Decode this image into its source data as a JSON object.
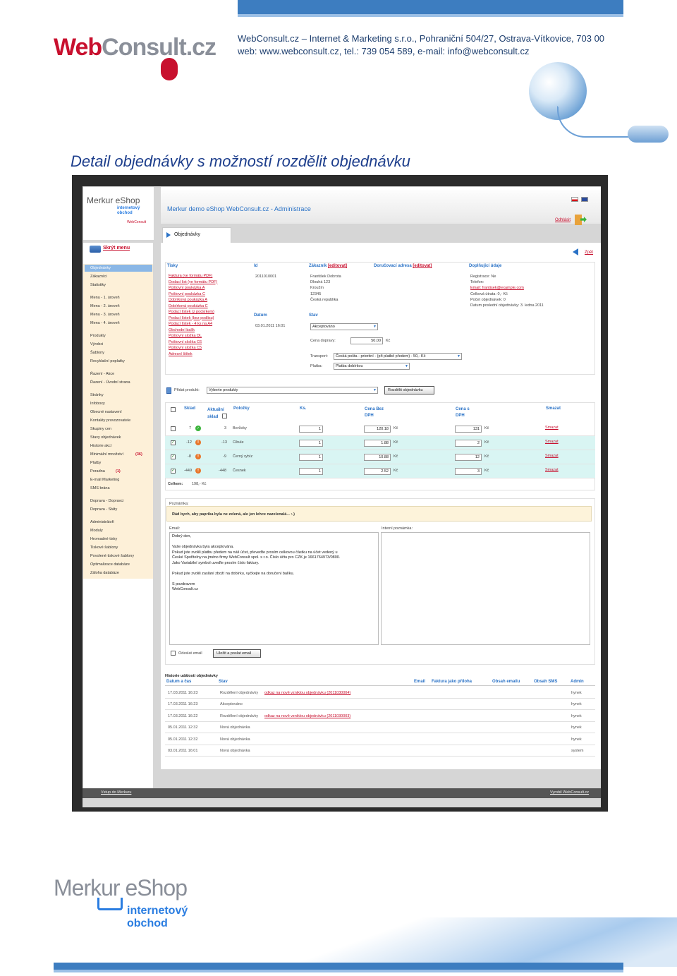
{
  "page": {
    "company_line1": "WebConsult.cz – Internet & Marketing s.r.o., Pohraniční 504/27, Ostrava-Vítkovice, 703 00",
    "company_line2": "web: www.webconsult.cz, tel.: 739 054 589, e-mail: info@webconsult.cz",
    "heading": "Detail objednávky s možností rozdělit objednávku",
    "logo_web": "Web",
    "logo_consult": "Consult.cz",
    "bottom_logo": "Merkur eShop",
    "bottom_logo_sub": "internetový obchod"
  },
  "app": {
    "sidebar_logo": "Merkur eShop",
    "sidebar_logo_sub": "internetový obchod",
    "sidebar_logo_small": "WebConsult",
    "admin_title": "Merkur demo eShop WebConsult.cz - Administrace",
    "logout": "Odhlásit",
    "tab": "Objednávky",
    "hide_menu": "Skrýt menu",
    "back": "Zpět",
    "menu": [
      "Objednávky",
      "Zákazníci",
      "Statistiky",
      "Menu - 1. úroveň",
      "Menu - 2. úroveň",
      "Menu - 3. úroveň",
      "Menu - 4. úroveň",
      "Produkty",
      "Výrobci",
      "Šablony",
      "Recyklační poplatky",
      "Řazení - Akce",
      "Řazení - Úvodní strana",
      "Stránky",
      "Infoboxy",
      "Obecné nastavení",
      "Kontakty provozovatele",
      "Skupiny cen",
      "Stavy objednávek",
      "Historie akcí",
      "Minimální množství",
      "Platby",
      "Poradna",
      "E-mail Marketing",
      "SMS brána",
      "Doprava - Dopravci",
      "Doprava - Státy",
      "Administrátoři",
      "Moduly",
      "Hromadné tisky",
      "Tiskové šablony",
      "Povolené tiskové šablony",
      "Optimalizace databáze",
      "Záloha databáze"
    ],
    "menu_badge_min": "(36)",
    "menu_badge_poradna": "(1)"
  },
  "order": {
    "headers": {
      "tisky": "Tisky",
      "id": "Id",
      "zakaznik": "Zákazník",
      "dorucovaci": "Doručovací adresa",
      "doplnujici": "Doplňující údaje",
      "editovat": "[editovat]",
      "datum": "Datum",
      "stav": "Stav"
    },
    "prints": [
      "Faktura (ve formátu PDF)",
      "Dodací list (ve formátu PDF)",
      "Poštovní poukázka A",
      "Poštovní poukázka C",
      "Dobírková poukázka A",
      "Dobírková poukázka C",
      "Podací lístek (z podsíkem)",
      "Podací lístek (bez podlisu)",
      "Podací lístek - 4 ks na A4",
      "Obchodní balík",
      "Poštovní složka DL",
      "Poštovní složka C6",
      "Poštovní složka C5",
      "Adresní štítek"
    ],
    "id": "2011010001",
    "customer": [
      "František Dobrota",
      "Dlouhá 123",
      "Kroužín",
      "12345",
      "Česká republika"
    ],
    "extra": [
      "Registrace: Ne",
      "Telefon:",
      "Email: frantisek@example.com",
      "Celková útrata: 0,- Kč",
      "Počet objednávek: 0",
      "Datum poslední objednávky: 3. ledna 2011"
    ],
    "date": "03.01.2011 16:01",
    "status": "Akceptováno",
    "shipping_price_label": "Cena dopravy:",
    "shipping_price": "50.00",
    "currency": "Kč",
    "transport_label": "Transport:",
    "transport": "Česká pošta - prioritní - (při platbě předem) - 50,- Kč",
    "payment_label": "Platba:",
    "payment": "Platba dobírkou"
  },
  "products": {
    "add_label": "Přidat produkt:",
    "add_placeholder": "Vyberte produkty",
    "split_button": "Rozdělit objednávku",
    "columns": [
      "Sklad",
      "Aktuální sklad",
      "Položky",
      "Ks.",
      "Cena Bez DPH",
      "Cena s DPH",
      "Smazat"
    ],
    "rows": [
      {
        "sklad": "7",
        "aktualni": "3",
        "name": "Borůvky",
        "ks": "1",
        "bez": "120.18",
        "s": "131",
        "ok": true,
        "checked": false
      },
      {
        "sklad": "-12",
        "aktualni": "-13",
        "name": "Cibule",
        "ks": "1",
        "bez": "1.88",
        "s": "2",
        "ok": false,
        "checked": true
      },
      {
        "sklad": "-8",
        "aktualni": "-9",
        "name": "Černý rybíz",
        "ks": "1",
        "bez": "10.88",
        "s": "12",
        "ok": false,
        "checked": true
      },
      {
        "sklad": "-449",
        "aktualni": "-448",
        "name": "Česnek",
        "ks": "1",
        "bez": "2.52",
        "s": "3",
        "ok": false,
        "checked": true
      }
    ],
    "delete": "Smazat",
    "total_label": "Celkem:",
    "total": "198,- Kč"
  },
  "notes": {
    "note_label": "Poznámka:",
    "note": "Rád bych, aby paprika byla ne zelená, ale jen lehce nazelenalá... :-)",
    "email_label": "Email:",
    "internal_label": "Interní poznámka:",
    "email_lines": [
      "Dobrý den,",
      "",
      "Vaše objednávka byla akceptována.",
      "Pokud jste zvolili platbu předem na náš účet, převeďte prosím celkovou částku na účet vedený u",
      "České Spořitelny na jméno firmy WebConsult spol. s r.o. Číslo účtu pro CZK je 1661764973/0800.",
      "Jako Variabilní symbol uveďte prosím číslo faktury.",
      "",
      "Pokud jste zvolili zaslání zboží na dobírku, vyčkejte na doručení balíku.",
      "",
      "S pozdravem",
      "WebConsult.cz"
    ],
    "send_email_label": "Odeslat email",
    "save_button": "Uložit a poslat email"
  },
  "history": {
    "title": "Historie událostí objednávky",
    "columns": [
      "Datum a čas",
      "Stav",
      "Email",
      "Faktura jako příloha",
      "Obsah emailu",
      "Obsah SMS",
      "Admin"
    ],
    "rows": [
      {
        "date": "17.03.2011 16:23",
        "status": "Rozdělení objednávky",
        "link": "odkaz na nově vzniklou objednávku (2011030004)",
        "admin": "hynek"
      },
      {
        "date": "17.03.2011 16:23",
        "status": "Akceptováno",
        "link": "",
        "admin": "hynek"
      },
      {
        "date": "17.03.2011 16:22",
        "status": "Rozdělení objednávky",
        "link": "odkaz na nově vzniklou objednávku (2011030003)",
        "admin": "hynek"
      },
      {
        "date": "05.01.2011 12:32",
        "status": "Nová objednávka",
        "link": "",
        "admin": "hynek"
      },
      {
        "date": "05.01.2011 12:32",
        "status": "Nová objednávka",
        "link": "",
        "admin": "hynek"
      },
      {
        "date": "03.01.2011 16:01",
        "status": "Nová objednávka",
        "link": "",
        "admin": "system"
      }
    ]
  },
  "footer": {
    "left": "Vstup do Merkuru",
    "right": "Vyrobil WebConsult.cz"
  }
}
